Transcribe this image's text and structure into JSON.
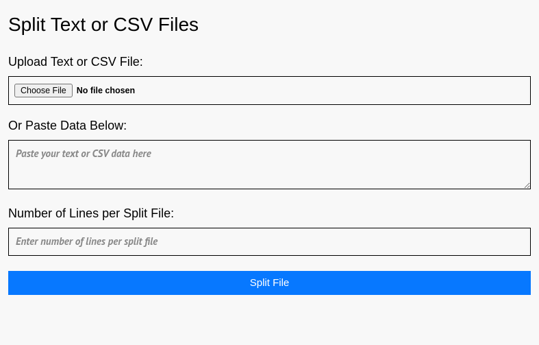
{
  "title": "Split Text or CSV Files",
  "upload": {
    "label": "Upload Text or CSV File:",
    "button_label": "Choose File",
    "status": "No file chosen"
  },
  "paste": {
    "label": "Or Paste Data Below:",
    "placeholder": "Paste your text or CSV data here",
    "value": ""
  },
  "lines": {
    "label": "Number of Lines per Split File:",
    "placeholder": "Enter number of lines per split file",
    "value": ""
  },
  "submit": {
    "label": "Split File"
  },
  "colors": {
    "accent": "#0778ff",
    "background": "#f8f8f8"
  }
}
